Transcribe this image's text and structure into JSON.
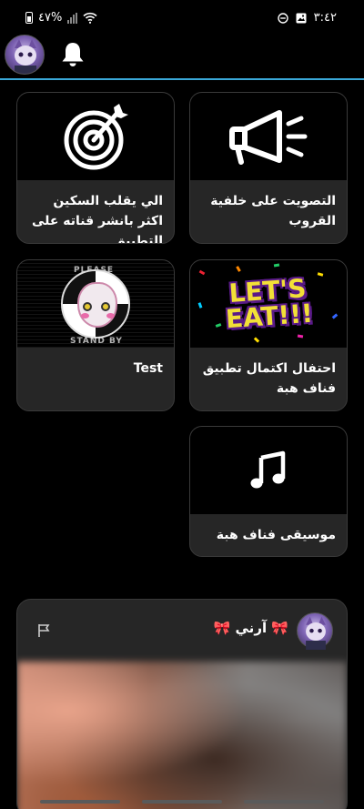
{
  "status_bar": {
    "time": "٣:٤٢",
    "battery_percent": "٤٧%"
  },
  "cards": [
    {
      "title": "التصويت على خلفية القروب",
      "icon": "megaphone-icon"
    },
    {
      "title": "الي يقلب السكين اكثر بانشر قناته على التطبيق",
      "icon": "target-icon"
    },
    {
      "title": "احتفال اكتمال تطبيق فناف هبة",
      "thumb_text": "LET'S EAT!!!"
    },
    {
      "title": "Test",
      "thumb_top_text": "PLEASE",
      "thumb_bottom_text": "STAND BY"
    },
    {
      "title": "موسيقى فناف هبة",
      "icon": "music-note-icon"
    }
  ],
  "post": {
    "author": "🎀 آرني 🎀"
  },
  "colors": {
    "accent": "#3aa8d8",
    "card_bg": "#262626"
  }
}
